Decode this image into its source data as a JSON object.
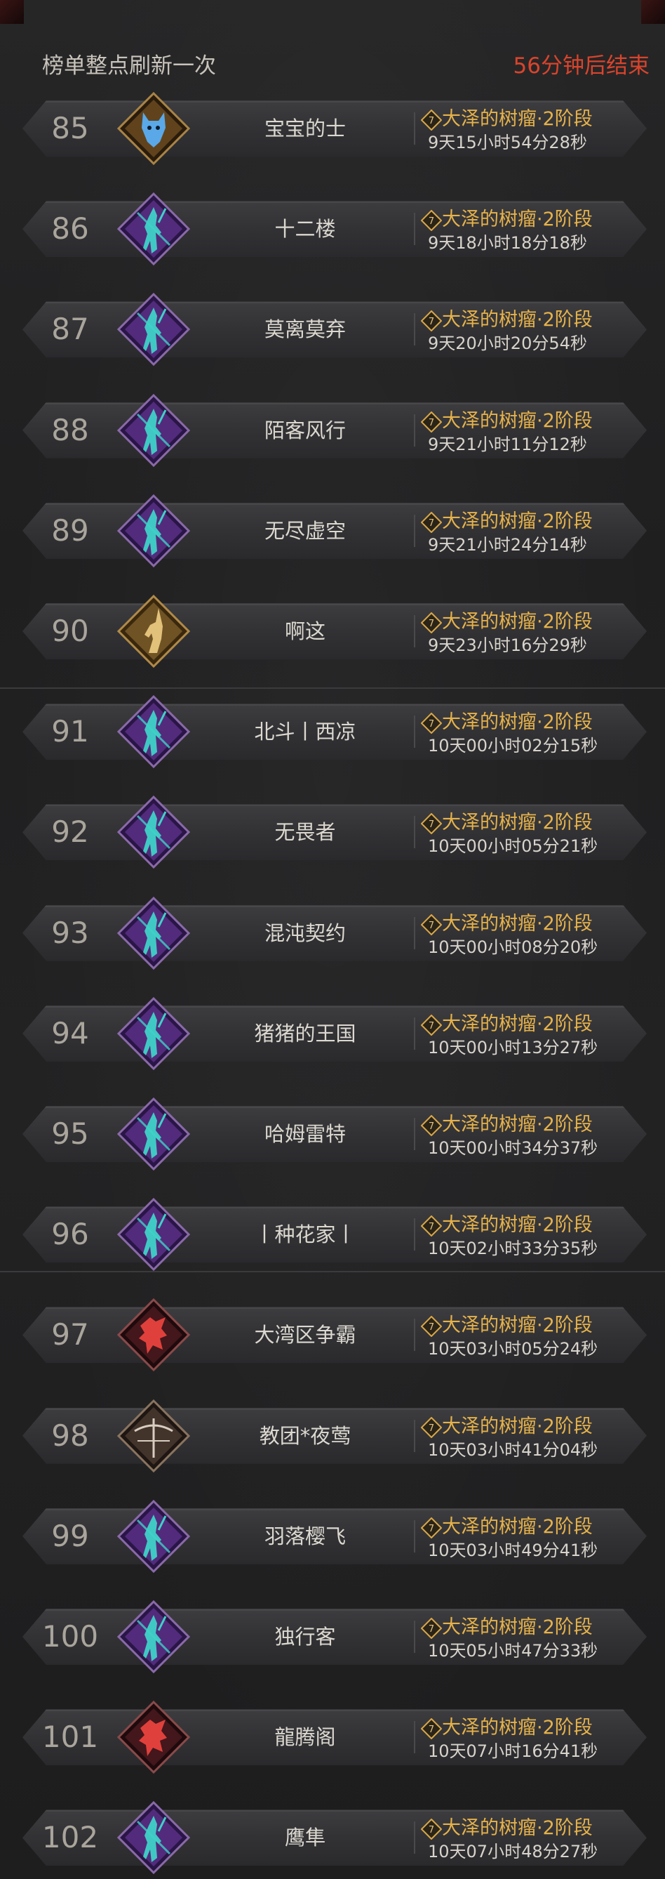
{
  "header": {
    "refresh_note": "榜单整点刷新一次",
    "countdown": "56分钟后结束"
  },
  "colors": {
    "accent_gold": "#e6b24a",
    "countdown_red": "#d9442c",
    "text_light": "#dcd8d0",
    "rank_grey": "#aaa59c"
  },
  "rows": [
    {
      "rank": "85",
      "name": "宝宝的士",
      "avatar": "wolf-emblem-icon",
      "stage": "大泽的树瘤·2阶段",
      "duration": "9天15小时54分28秒"
    },
    {
      "rank": "86",
      "name": "十二楼",
      "avatar": "rogue-emblem-icon",
      "stage": "大泽的树瘤·2阶段",
      "duration": "9天18小时18分18秒"
    },
    {
      "rank": "87",
      "name": "莫离莫弃",
      "avatar": "rogue-emblem-icon",
      "stage": "大泽的树瘤·2阶段",
      "duration": "9天20小时20分54秒"
    },
    {
      "rank": "88",
      "name": "陌客风行",
      "avatar": "rogue-emblem-icon",
      "stage": "大泽的树瘤·2阶段",
      "duration": "9天21小时11分12秒"
    },
    {
      "rank": "89",
      "name": "无尽虚空",
      "avatar": "rogue-emblem-icon",
      "stage": "大泽的树瘤·2阶段",
      "duration": "9天21小时24分14秒"
    },
    {
      "rank": "90",
      "name": "啊这",
      "avatar": "unicorn-emblem-icon",
      "stage": "大泽的树瘤·2阶段",
      "duration": "9天23小时16分29秒"
    },
    {
      "rank": "91",
      "name": "北斗丨西凉",
      "avatar": "rogue-emblem-icon",
      "stage": "大泽的树瘤·2阶段",
      "duration": "10天00小时02分15秒"
    },
    {
      "rank": "92",
      "name": "无畏者",
      "avatar": "rogue-emblem-icon",
      "stage": "大泽的树瘤·2阶段",
      "duration": "10天00小时05分21秒"
    },
    {
      "rank": "93",
      "name": "混沌契约",
      "avatar": "rogue-emblem-icon",
      "stage": "大泽的树瘤·2阶段",
      "duration": "10天00小时08分20秒"
    },
    {
      "rank": "94",
      "name": "猪猪的王国",
      "avatar": "rogue-emblem-icon",
      "stage": "大泽的树瘤·2阶段",
      "duration": "10天00小时13分27秒"
    },
    {
      "rank": "95",
      "name": "哈姆雷特",
      "avatar": "rogue-emblem-icon",
      "stage": "大泽的树瘤·2阶段",
      "duration": "10天00小时34分37秒"
    },
    {
      "rank": "96",
      "name": "丨种花家丨",
      "avatar": "rogue-emblem-icon",
      "stage": "大泽的树瘤·2阶段",
      "duration": "10天02小时33分35秒"
    },
    {
      "rank": "97",
      "name": "大湾区争霸",
      "avatar": "dragon-emblem-icon",
      "stage": "大泽的树瘤·2阶段",
      "duration": "10天03小时05分24秒"
    },
    {
      "rank": "98",
      "name": "教团*夜莺",
      "avatar": "crossbow-emblem-icon",
      "stage": "大泽的树瘤·2阶段",
      "duration": "10天03小时41分04秒"
    },
    {
      "rank": "99",
      "name": "羽落樱飞",
      "avatar": "rogue-emblem-icon",
      "stage": "大泽的树瘤·2阶段",
      "duration": "10天03小时49分41秒"
    },
    {
      "rank": "100",
      "name": "独行客",
      "avatar": "rogue-emblem-icon",
      "stage": "大泽的树瘤·2阶段",
      "duration": "10天05小时47分33秒"
    },
    {
      "rank": "101",
      "name": "龍腾阁",
      "avatar": "dragon-emblem-icon",
      "stage": "大泽的树瘤·2阶段",
      "duration": "10天07小时16分41秒"
    },
    {
      "rank": "102",
      "name": "鹰隼",
      "avatar": "rogue-emblem-icon",
      "stage": "大泽的树瘤·2阶段",
      "duration": "10天07小时48分27秒"
    }
  ]
}
